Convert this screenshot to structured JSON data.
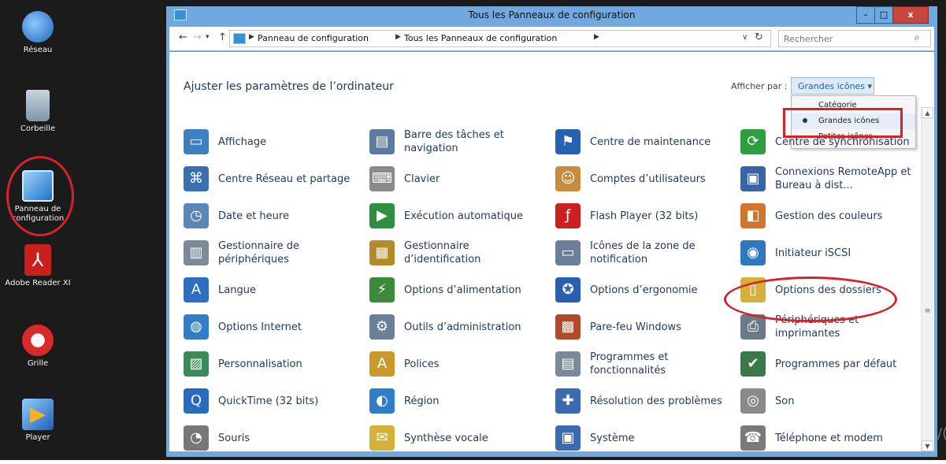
{
  "desktop": {
    "icons": [
      {
        "label": "Réseau",
        "icon": "network-globe-icon",
        "color": "#2d7ed8"
      },
      {
        "label": "Corbeille",
        "icon": "recycle-bin-icon",
        "color": "#8aa3b8"
      },
      {
        "label": "Panneau de configuration",
        "icon": "control-panel-icon",
        "color": "#2f8fe6"
      },
      {
        "label": "Adobe Reader XI",
        "icon": "adobe-reader-icon",
        "color": "#c91f1f"
      },
      {
        "label": "Grille",
        "icon": "grille-app-icon",
        "color": "#d92a2a"
      },
      {
        "label": "Player",
        "icon": "player-icon",
        "color": "#3a7fd6"
      }
    ],
    "side_glyph": "/("
  },
  "window": {
    "title": "Tous les Panneaux de configuration",
    "buttons": {
      "minimize": "–",
      "maximize": "□",
      "close": "x"
    }
  },
  "navbar": {
    "back": "←",
    "forward": "→",
    "recent": "▾",
    "up": "↑",
    "breadcrumb": [
      "Panneau de configuration",
      "Tous les Panneaux de configuration"
    ],
    "dropdown": "∨",
    "refresh": "↻",
    "search_placeholder": "Rechercher",
    "search_glyph": "⌕"
  },
  "header": {
    "heading": "Ajuster les paramètres de l’ordinateur",
    "view_label": "Afficher par :",
    "view_selected": "Grandes icônes ▾",
    "view_options": [
      "Catégorie",
      "Grandes icônes",
      "Petites icônes"
    ],
    "view_selected_index": 1
  },
  "items": [
    {
      "label": "Affichage",
      "icon": "display-icon",
      "color": "#3d7fc1",
      "glyph": "▭"
    },
    {
      "label": "Barre des tâches et navigation",
      "icon": "taskbar-icon",
      "color": "#5d7aa2",
      "glyph": "▤"
    },
    {
      "label": "Centre de maintenance",
      "icon": "action-center-flag-icon",
      "color": "#2762b0",
      "glyph": "⚑"
    },
    {
      "label": "Centre de synchronisation",
      "icon": "sync-center-icon",
      "color": "#2e9e3e",
      "glyph": "⟳"
    },
    {
      "label": "Centre Réseau et partage",
      "icon": "network-sharing-icon",
      "color": "#3a6fb0",
      "glyph": "⌘"
    },
    {
      "label": "Clavier",
      "icon": "keyboard-icon",
      "color": "#8a8a8a",
      "glyph": "⌨"
    },
    {
      "label": "Comptes d’utilisateurs",
      "icon": "user-accounts-icon",
      "color": "#c98c3a",
      "glyph": "☺"
    },
    {
      "label": "Connexions RemoteApp et Bureau à dist...",
      "icon": "remoteapp-icon",
      "color": "#3a64a8",
      "glyph": "▣"
    },
    {
      "label": "Date et heure",
      "icon": "date-time-icon",
      "color": "#5b87b8",
      "glyph": "◷"
    },
    {
      "label": "Exécution automatique",
      "icon": "autoplay-icon",
      "color": "#2f8f3f",
      "glyph": "▶"
    },
    {
      "label": "Flash Player (32 bits)",
      "icon": "flash-player-icon",
      "color": "#cc1f1f",
      "glyph": "ƒ"
    },
    {
      "label": "Gestion des couleurs",
      "icon": "color-management-icon",
      "color": "#d0762a",
      "glyph": "◧"
    },
    {
      "label": "Gestionnaire de périphériques",
      "icon": "device-manager-icon",
      "color": "#7a8a99",
      "glyph": "▥"
    },
    {
      "label": "Gestionnaire d’identification",
      "icon": "credential-manager-icon",
      "color": "#b58a2a",
      "glyph": "▦"
    },
    {
      "label": "Icônes de la zone de notification",
      "icon": "notification-area-icon",
      "color": "#6a7f99",
      "glyph": "▭"
    },
    {
      "label": "Initiateur iSCSI",
      "icon": "iscsi-initiator-icon",
      "color": "#2e78c0",
      "glyph": "◉"
    },
    {
      "label": "Langue",
      "icon": "language-icon",
      "color": "#2a6fc0",
      "glyph": "A"
    },
    {
      "label": "Options d’alimentation",
      "icon": "power-options-icon",
      "color": "#3a8a3a",
      "glyph": "⚡"
    },
    {
      "label": "Options d’ergonomie",
      "icon": "ease-of-access-icon",
      "color": "#2a5fb0",
      "glyph": "✪"
    },
    {
      "label": "Options des dossiers",
      "icon": "folder-options-icon",
      "color": "#d6b13a",
      "glyph": "▯"
    },
    {
      "label": "Options Internet",
      "icon": "internet-options-icon",
      "color": "#2e7fc8",
      "glyph": "◍"
    },
    {
      "label": "Outils d’administration",
      "icon": "admin-tools-icon",
      "color": "#6a7f99",
      "glyph": "⚙"
    },
    {
      "label": "Pare-feu Windows",
      "icon": "firewall-icon",
      "color": "#b04a2a",
      "glyph": "▩"
    },
    {
      "label": "Périphériques et imprimantes",
      "icon": "devices-printers-icon",
      "color": "#6a7a8a",
      "glyph": "⎙"
    },
    {
      "label": "Personnalisation",
      "icon": "personalization-icon",
      "color": "#3a8a5a",
      "glyph": "▨"
    },
    {
      "label": "Polices",
      "icon": "fonts-icon",
      "color": "#c99a2a",
      "glyph": "A"
    },
    {
      "label": "Programmes et fonctionnalités",
      "icon": "programs-features-icon",
      "color": "#7a8a99",
      "glyph": "▤"
    },
    {
      "label": "Programmes par défaut",
      "icon": "default-programs-icon",
      "color": "#3a7a4a",
      "glyph": "✔"
    },
    {
      "label": "QuickTime (32 bits)",
      "icon": "quicktime-icon",
      "color": "#2a6ac0",
      "glyph": "Q"
    },
    {
      "label": "Région",
      "icon": "region-globe-icon",
      "color": "#2e7fc8",
      "glyph": "◐"
    },
    {
      "label": "Résolution des problèmes",
      "icon": "troubleshooting-icon",
      "color": "#3a6ab0",
      "glyph": "✚"
    },
    {
      "label": "Son",
      "icon": "sound-icon",
      "color": "#8a8a8a",
      "glyph": "◎"
    },
    {
      "label": "Souris",
      "icon": "mouse-icon",
      "color": "#777777",
      "glyph": "◔"
    },
    {
      "label": "Synthèse vocale",
      "icon": "speech-icon",
      "color": "#d6b13a",
      "glyph": "✉"
    },
    {
      "label": "Système",
      "icon": "system-icon",
      "color": "#3a6ab0",
      "glyph": "▣"
    },
    {
      "label": "Téléphone et modem",
      "icon": "phone-modem-icon",
      "color": "#7a7a7a",
      "glyph": "☎"
    }
  ]
}
